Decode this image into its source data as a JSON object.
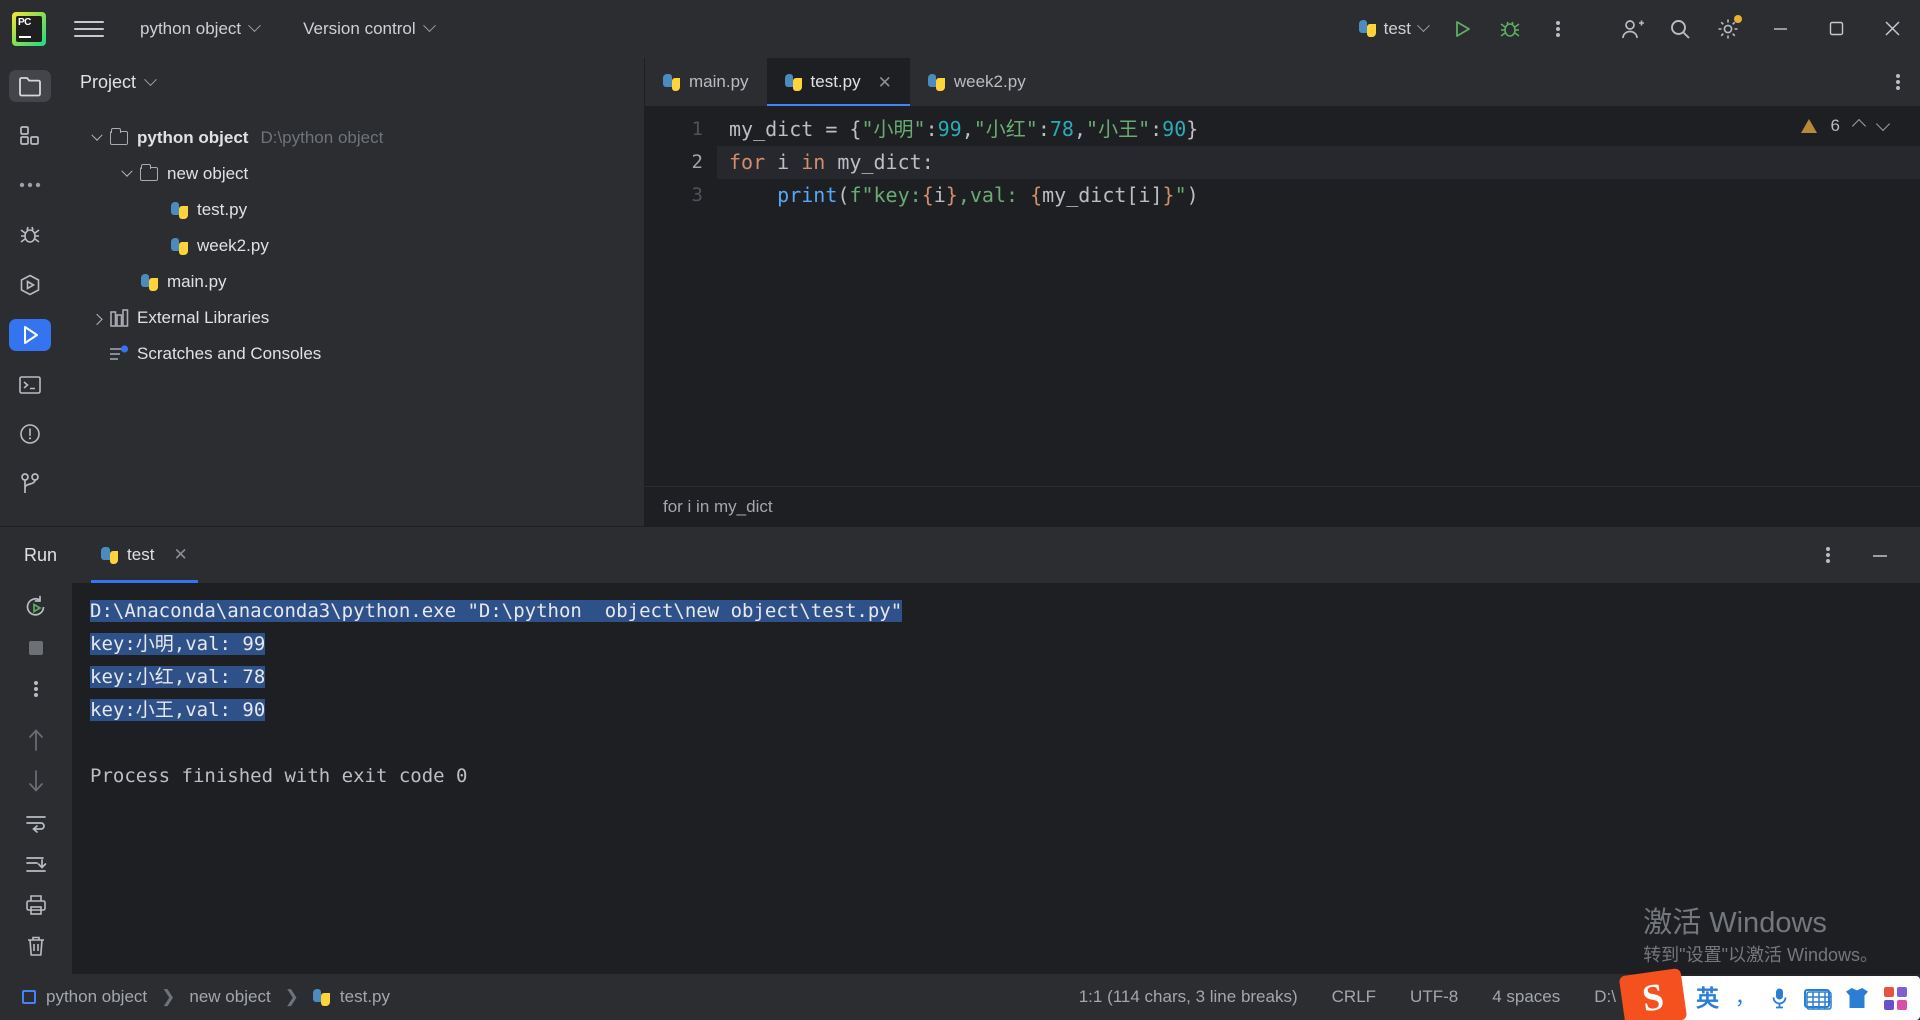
{
  "titlebar": {
    "logo": "pycharm-logo",
    "project_menu": "python  object",
    "vcs_menu": "Version control",
    "run_config": "test",
    "icons": [
      "hamburger-icon",
      "run-icon",
      "debug-icon",
      "more-icon",
      "account-icon",
      "search-icon",
      "settings-icon"
    ],
    "window_minimize": "–",
    "window_maximize": "▢",
    "window_close": "✕"
  },
  "leftbar": {
    "top": [
      "project-icon",
      "structure-icon",
      "more-tools-icon"
    ],
    "bottom": [
      "debug-icon",
      "run-config-icon",
      "run-icon",
      "terminal-icon",
      "problems-icon",
      "version-control-icon"
    ]
  },
  "project": {
    "title": "Project",
    "tree": [
      {
        "label": "python object",
        "path": "D:\\python  object",
        "indent": 0,
        "type": "folder",
        "arrow": "down",
        "bold": true
      },
      {
        "label": "new object",
        "path": "",
        "indent": 1,
        "type": "folder",
        "arrow": "down",
        "bold": false
      },
      {
        "label": "test.py",
        "path": "",
        "indent": 2,
        "type": "python",
        "arrow": "none",
        "bold": false
      },
      {
        "label": "week2.py",
        "path": "",
        "indent": 2,
        "type": "python",
        "arrow": "none",
        "bold": false
      },
      {
        "label": "main.py",
        "path": "",
        "indent": 1,
        "type": "python",
        "arrow": "none",
        "bold": false
      },
      {
        "label": "External Libraries",
        "path": "",
        "indent": 0,
        "type": "library",
        "arrow": "right",
        "bold": false
      },
      {
        "label": "Scratches and Consoles",
        "path": "",
        "indent": 0,
        "type": "scratches",
        "arrow": "none",
        "bold": false
      }
    ]
  },
  "editor": {
    "tabs": [
      {
        "label": "main.py",
        "active": false,
        "closable": false
      },
      {
        "label": "test.py",
        "active": true,
        "closable": true
      },
      {
        "label": "week2.py",
        "active": false,
        "closable": false
      }
    ],
    "line_numbers": [
      "1",
      "2",
      "3"
    ],
    "code_lines": [
      {
        "n": "1",
        "tokens": [
          {
            "t": "my_dict ",
            "c": "var"
          },
          {
            "t": "= ",
            "c": "op"
          },
          {
            "t": "{",
            "c": "brace"
          },
          {
            "t": "\"小明\"",
            "c": "str"
          },
          {
            "t": ":",
            "c": "op"
          },
          {
            "t": "99",
            "c": "num"
          },
          {
            "t": ",",
            "c": "op"
          },
          {
            "t": "\"小红\"",
            "c": "str"
          },
          {
            "t": ":",
            "c": "op"
          },
          {
            "t": "78",
            "c": "num"
          },
          {
            "t": ",",
            "c": "op"
          },
          {
            "t": "\"小王\"",
            "c": "str"
          },
          {
            "t": ":",
            "c": "op"
          },
          {
            "t": "90",
            "c": "num"
          },
          {
            "t": "}",
            "c": "brace"
          }
        ]
      },
      {
        "n": "2",
        "tokens": [
          {
            "t": "for ",
            "c": "def"
          },
          {
            "t": "i ",
            "c": "var"
          },
          {
            "t": "in ",
            "c": "def"
          },
          {
            "t": "my_dict",
            "c": "var"
          },
          {
            "t": ":",
            "c": "op"
          }
        ]
      },
      {
        "n": "3",
        "tokens": [
          {
            "t": "    ",
            "c": "op"
          },
          {
            "t": "print",
            "c": "fun"
          },
          {
            "t": "(",
            "c": "brace"
          },
          {
            "t": "f\"key:",
            "c": "str"
          },
          {
            "t": "{",
            "c": "fbrace"
          },
          {
            "t": "i",
            "c": "var"
          },
          {
            "t": "}",
            "c": "fbrace"
          },
          {
            "t": ",val: ",
            "c": "str"
          },
          {
            "t": "{",
            "c": "fbrace"
          },
          {
            "t": "my_dict[i]",
            "c": "var"
          },
          {
            "t": "}",
            "c": "fbrace"
          },
          {
            "t": "\"",
            "c": "str"
          },
          {
            "t": ")",
            "c": "brace"
          }
        ]
      }
    ],
    "inspection_count": "6",
    "inspection_icon": "warning-icon",
    "breadcrumb": "for i in my_dict"
  },
  "run": {
    "title": "Run",
    "tab_label": "test",
    "tools": [
      "rerun-icon",
      "stop-icon",
      "more-icon",
      "up-arrow-icon",
      "down-arrow-icon",
      "soft-wrap-icon",
      "scroll-to-end-icon",
      "print-icon",
      "clear-all-icon"
    ],
    "console_lines": [
      {
        "text": "D:\\Anaconda\\anaconda3\\python.exe \"D:\\python  object\\new object\\test.py\"",
        "selected": true
      },
      {
        "text": "key:小明,val: 99",
        "selected": true
      },
      {
        "text": "key:小红,val: 78",
        "selected": true
      },
      {
        "text": "key:小王,val: 90",
        "selected": true
      },
      {
        "text": "",
        "selected": false
      },
      {
        "text": "Process finished with exit code 0",
        "selected": false
      }
    ],
    "minimize_icon": "minimize-icon",
    "options_icon": "more-icon"
  },
  "watermark": {
    "line1": "激活 Windows",
    "line2": "转到\"设置\"以激活 Windows。"
  },
  "status": {
    "breadcrumbs": [
      "python  object",
      "new object",
      "test.py"
    ],
    "caret": "1:1 (114 chars, 3 line breaks)",
    "line_sep": "CRLF",
    "encoding": "UTF-8",
    "indent": "4 spaces",
    "path_fragment": "D:\\"
  },
  "ime": {
    "brand": "S",
    "mode": "英",
    "punct": "，",
    "icons": [
      "mic-icon",
      "keyboard-icon",
      "skin-icon",
      "apps-icon"
    ]
  },
  "colors": {
    "accent": "#3574f0",
    "bg_main": "#2b2d30",
    "bg_editor": "#1e1f22",
    "selection": "#2f5189",
    "warning": "#b8893b",
    "string": "#6aab73",
    "keyword": "#cf8e6d",
    "number": "#2aacb8",
    "function": "#56a8f5"
  }
}
